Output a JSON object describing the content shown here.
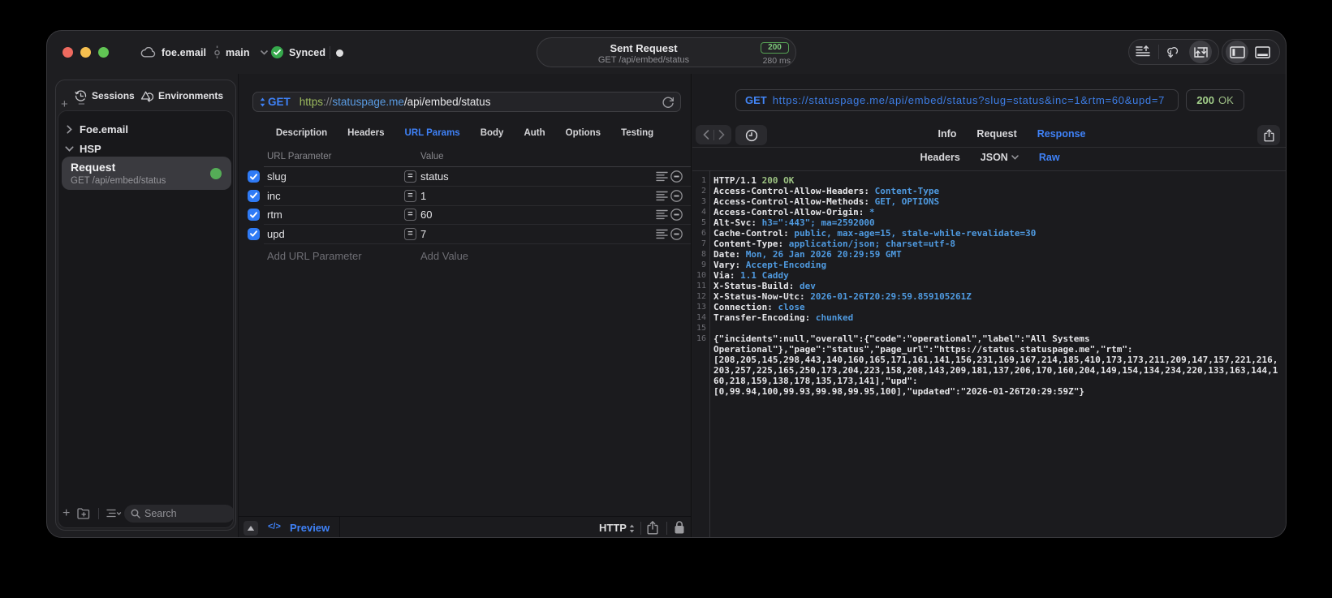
{
  "titlebar": {
    "project": "foe.email",
    "branch": "main",
    "sync_status": "Synced",
    "request_pill": {
      "title": "Sent Request",
      "subtitle": "GET /api/embed/status",
      "status_code": "200",
      "duration": "280 ms"
    }
  },
  "sidebar": {
    "tabs": [
      {
        "label": "Sessions",
        "icon": "history-icon"
      },
      {
        "label": "Environments",
        "icon": "environments-icon"
      }
    ],
    "tree": [
      {
        "label": "Foe.email",
        "expanded": false
      },
      {
        "label": "HSP",
        "expanded": true
      }
    ],
    "selected_request": {
      "title": "Request",
      "subtitle": "GET /api/embed/status",
      "status_dot": "green"
    },
    "search_placeholder": "Search"
  },
  "request_pane": {
    "method": "GET",
    "url_scheme": "https",
    "url_separator": "://",
    "url_host": "statuspage.me",
    "url_path": "/api/embed/status",
    "tabs": [
      "Description",
      "Headers",
      "URL Params",
      "Body",
      "Auth",
      "Options",
      "Testing"
    ],
    "active_tab": "URL Params",
    "param_table": {
      "columns": [
        "URL Parameter",
        "Value"
      ],
      "rows": [
        {
          "name": "slug",
          "value": "status",
          "enabled": true
        },
        {
          "name": "inc",
          "value": "1",
          "enabled": true
        },
        {
          "name": "rtm",
          "value": "60",
          "enabled": true
        },
        {
          "name": "upd",
          "value": "7",
          "enabled": true
        }
      ],
      "add_name_placeholder": "Add URL Parameter",
      "add_value_placeholder": "Add Value"
    },
    "statusbar": {
      "preview_label": "Preview",
      "protocol": "HTTP"
    }
  },
  "response_pane": {
    "method": "GET",
    "url": "https://statuspage.me/api/embed/status?slug=status&inc=1&rtm=60&upd=7",
    "status_code": "200",
    "status_text": "OK",
    "tabs": [
      "Info",
      "Request",
      "Response"
    ],
    "active_tab": "Response",
    "subtabs": [
      "Headers",
      "JSON",
      "Raw"
    ],
    "active_subtab": "Raw",
    "body_lines": [
      {
        "num": "1",
        "segments": [
          {
            "t": "HTTP/1.1 ",
            "c": "plain"
          },
          {
            "t": "200 OK",
            "c": "green"
          }
        ]
      },
      {
        "num": "2",
        "segments": [
          {
            "t": "Access-Control-Allow-Headers:",
            "c": "name"
          },
          {
            "t": " Content-Type",
            "c": "value"
          }
        ]
      },
      {
        "num": "3",
        "segments": [
          {
            "t": "Access-Control-Allow-Methods:",
            "c": "name"
          },
          {
            "t": " GET, OPTIONS",
            "c": "value"
          }
        ]
      },
      {
        "num": "4",
        "segments": [
          {
            "t": "Access-Control-Allow-Origin:",
            "c": "name"
          },
          {
            "t": " *",
            "c": "value"
          }
        ]
      },
      {
        "num": "5",
        "segments": [
          {
            "t": "Alt-Svc:",
            "c": "name"
          },
          {
            "t": " h3=\":443\"; ma=2592000",
            "c": "value"
          }
        ]
      },
      {
        "num": "6",
        "segments": [
          {
            "t": "Cache-Control:",
            "c": "name"
          },
          {
            "t": " public, max-age=15, stale-while-revalidate=30",
            "c": "value"
          }
        ]
      },
      {
        "num": "7",
        "segments": [
          {
            "t": "Content-Type:",
            "c": "name"
          },
          {
            "t": " application/json; charset=utf-8",
            "c": "value"
          }
        ]
      },
      {
        "num": "8",
        "segments": [
          {
            "t": "Date:",
            "c": "name"
          },
          {
            "t": " Mon, 26 Jan 2026 20:29:59 GMT",
            "c": "value"
          }
        ]
      },
      {
        "num": "9",
        "segments": [
          {
            "t": "Vary:",
            "c": "name"
          },
          {
            "t": " Accept-Encoding",
            "c": "value"
          }
        ]
      },
      {
        "num": "10",
        "segments": [
          {
            "t": "Via:",
            "c": "name"
          },
          {
            "t": " 1.1 Caddy",
            "c": "value"
          }
        ]
      },
      {
        "num": "11",
        "segments": [
          {
            "t": "X-Status-Build:",
            "c": "name"
          },
          {
            "t": " dev",
            "c": "value"
          }
        ]
      },
      {
        "num": "12",
        "segments": [
          {
            "t": "X-Status-Now-Utc:",
            "c": "name"
          },
          {
            "t": " 2026-01-26T20:29:59.859105261Z",
            "c": "value"
          }
        ]
      },
      {
        "num": "13",
        "segments": [
          {
            "t": "Connection:",
            "c": "name"
          },
          {
            "t": " close",
            "c": "value"
          }
        ]
      },
      {
        "num": "14",
        "segments": [
          {
            "t": "Transfer-Encoding:",
            "c": "name"
          },
          {
            "t": " chunked",
            "c": "value"
          }
        ]
      },
      {
        "num": "15",
        "segments": []
      },
      {
        "num": "16",
        "segments": [
          {
            "t": "{\"incidents\":null,\"overall\":{\"code\":\"operational\",\"label\":\"All Systems ",
            "c": "plain"
          }
        ]
      },
      {
        "num": "",
        "segments": [
          {
            "t": "Operational\"},\"page\":\"status\",\"page_url\":\"https://status.statuspage.me\",\"rtm\":",
            "c": "plain"
          }
        ]
      },
      {
        "num": "",
        "segments": [
          {
            "t": "[208,205,145,298,443,140,160,165,171,161,141,156,231,169,167,214,185,410,173,173,211,209,147,157,221,216,",
            "c": "plain"
          }
        ]
      },
      {
        "num": "",
        "segments": [
          {
            "t": "203,257,225,165,250,173,204,223,158,208,143,209,181,137,206,170,160,204,149,154,134,234,220,133,163,144,1",
            "c": "plain"
          }
        ]
      },
      {
        "num": "",
        "segments": [
          {
            "t": "60,218,159,138,178,135,173,141],\"upd\":",
            "c": "plain"
          }
        ]
      },
      {
        "num": "",
        "segments": [
          {
            "t": "[0,99.94,100,99.93,99.98,99.95,100],\"updated\":\"2026-01-26T20:29:59Z\"}",
            "c": "plain"
          }
        ]
      }
    ]
  }
}
